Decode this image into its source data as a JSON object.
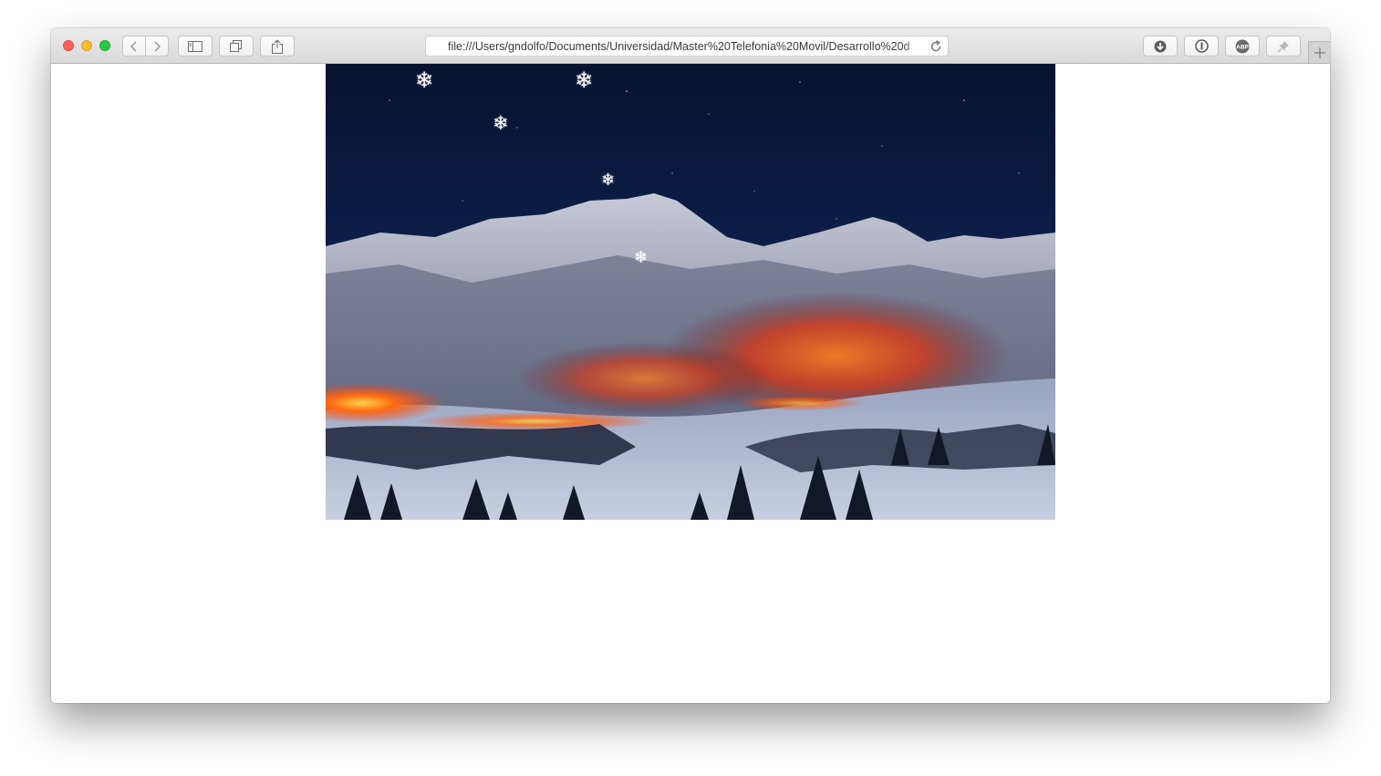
{
  "browser": {
    "address_url": "file:///Users/gndolfo/Documents/Universidad/Master%20Telefonia%20Movil/Desarrollo%20d",
    "toolbar_icons": [
      "back-icon",
      "forward-icon",
      "sidebar-icon",
      "tabs-overview-icon",
      "share-icon",
      "reload-icon",
      "downloads-icon",
      "password-manager-icon",
      "adblock-icon",
      "pin-icon",
      "new-tab-icon"
    ],
    "extension_label": "ABP"
  },
  "page": {
    "image_subject": "snowy mountains at night with glowing orange lights",
    "snowflake_glyph": "❄",
    "colors": {
      "sky": "#0a1a3e",
      "snow": "#c9cfe0",
      "glow": "#ff5a14"
    }
  }
}
